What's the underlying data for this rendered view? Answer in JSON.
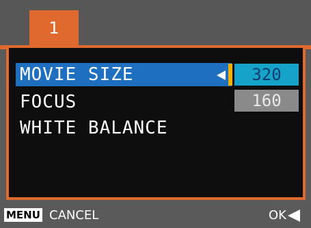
{
  "tab": {
    "label": "1"
  },
  "menu": {
    "items": [
      {
        "label": "MOVIE SIZE",
        "selected": true
      },
      {
        "label": "FOCUS",
        "selected": false
      },
      {
        "label": "WHITE BALANCE",
        "selected": false
      }
    ],
    "options": [
      {
        "value": "320",
        "selected": true
      },
      {
        "value": "160",
        "selected": false
      }
    ]
  },
  "footer": {
    "menu_key": "MENU",
    "cancel_label": "CANCEL",
    "ok_label": "OK"
  },
  "colors": {
    "accent": "#e06a2e",
    "selection": "#1f6fc0",
    "selected_value": "#16a3c9",
    "marker": "#f4b000"
  }
}
